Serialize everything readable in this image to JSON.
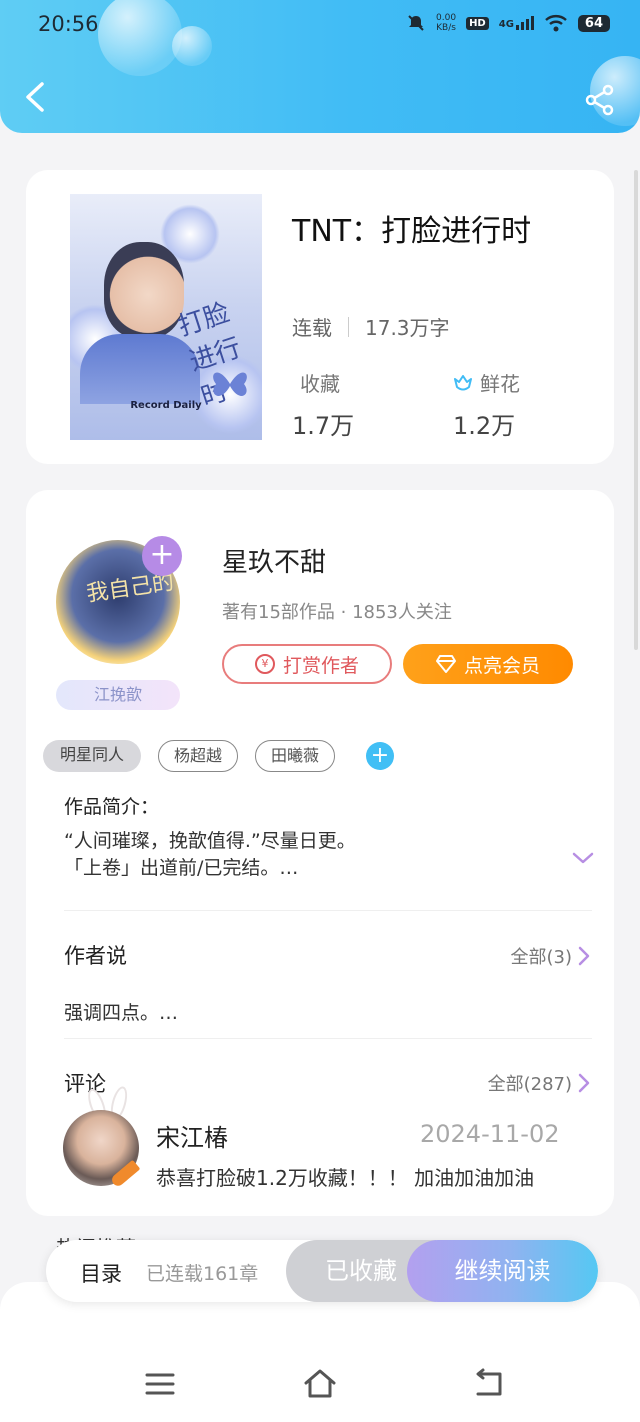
{
  "status_bar": {
    "time": "20:56",
    "net_speed_value": "0.00",
    "net_speed_unit": "KB/s",
    "hd": "HD",
    "network": "4G",
    "battery": "64"
  },
  "header": {
    "back_icon": "chevron-left-icon",
    "share_icon": "share-icon"
  },
  "book": {
    "title": "TNT：打脸进行时",
    "status": "连载",
    "word_count": "17.3万字",
    "favorites_label": "收藏",
    "favorites_value": "1.7万",
    "flowers_label": "鲜花",
    "flowers_value": "1.2万",
    "cover_title": "打脸进行时",
    "cover_caption": "Record Daily"
  },
  "author": {
    "name": "星玖不甜",
    "stats": "著有15部作品 · 1853人关注",
    "badge": "江挽歆",
    "avatar_text": "我自己的",
    "tip_label": "打赏作者",
    "vip_label": "点亮会员"
  },
  "tags": [
    "明星同人",
    "杨超越",
    "田曦薇"
  ],
  "intro": {
    "title": "作品简介：",
    "line1": "“人间璀璨，挽歆值得.”尽量日更。",
    "line2": "「上卷」出道前/已完结。…"
  },
  "author_says": {
    "title": "作者说",
    "see_all": "全部(3)",
    "text": "强调四点。…"
  },
  "comments": {
    "title": "评论",
    "see_all": "全部(287)",
    "items": [
      {
        "user": "宋江椿",
        "date": "2024-11-02",
        "text": "恭喜打脸破1.2万收藏！！！ 加油加油加油"
      }
    ]
  },
  "peek_text": "热门推荐",
  "action_bar": {
    "toc": "目录",
    "chapters": "已连载161章",
    "favorited": "已收藏",
    "continue": "继续阅读"
  },
  "colors": {
    "header_blue": "#41bcf5",
    "tip_red": "#e0595d",
    "vip_orange": "#ff8a00",
    "accent_purple": "#b68be6"
  }
}
